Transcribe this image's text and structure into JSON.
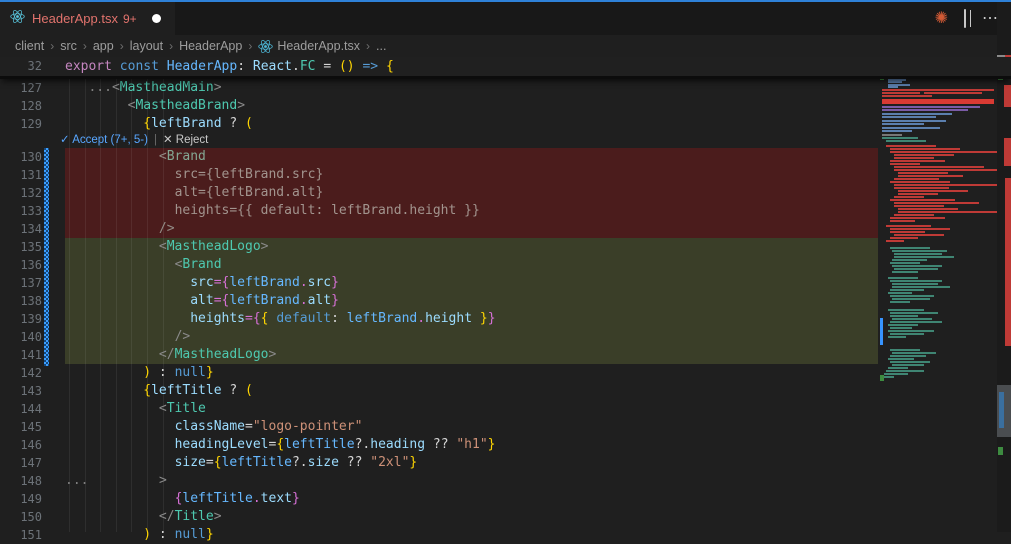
{
  "tab_bar": {
    "accent_color": "#2e81d8",
    "tab": {
      "icon": "react-icon",
      "title": "HeaderApp.tsx",
      "badge": "9+",
      "dirty": true,
      "title_color": "#e2736d"
    },
    "actions": [
      {
        "name": "ai-sparkle-icon",
        "glyph": "✺",
        "color": "#d15a35"
      },
      {
        "name": "split-editor-icon",
        "glyph": ""
      },
      {
        "name": "more-actions-icon",
        "glyph": "⋯"
      }
    ]
  },
  "breadcrumb": {
    "separator": "›",
    "segments": [
      {
        "label": "client"
      },
      {
        "label": "src"
      },
      {
        "label": "app"
      },
      {
        "label": "layout"
      },
      {
        "label": "HeaderApp"
      },
      {
        "label": "HeaderApp.tsx",
        "icon": "react-icon"
      },
      {
        "label": "..."
      }
    ]
  },
  "diff_bar": {
    "accept_label": "✓ Accept (7+, 5-)",
    "separator": "|",
    "reject_label": "✕ Reject",
    "accept_color": "#58a6ff"
  },
  "editor": {
    "background": "#1f1f1f",
    "deleted_line_bg": "#4b1c1c",
    "added_line_bg": "#3a3e28",
    "sticky_line": {
      "n": "32",
      "ind": 0,
      "tok": [
        [
          "export",
          "kw"
        ],
        [
          " ",
          "op"
        ],
        [
          "const",
          "kw2"
        ],
        [
          " ",
          "op"
        ],
        [
          "HeaderApp",
          "var2"
        ],
        [
          ": ",
          "op"
        ],
        [
          "React",
          "var"
        ],
        [
          ".",
          "op"
        ],
        [
          "FC",
          "type"
        ],
        [
          " = ",
          "op"
        ],
        [
          "()",
          "b1"
        ],
        [
          " ",
          "op"
        ],
        [
          "=>",
          "kw2"
        ],
        [
          " ",
          "op"
        ],
        [
          "{",
          "b1"
        ]
      ]
    },
    "code_lines": [
      {
        "n": "127",
        "kind": "normal",
        "ind": 3,
        "tok": [
          [
            "...",
            "dots"
          ],
          [
            "<",
            "punct"
          ],
          [
            "MastheadMain",
            "type"
          ],
          [
            ">",
            "punct"
          ]
        ]
      },
      {
        "n": "128",
        "kind": "normal",
        "ind": 8,
        "tok": [
          [
            "<",
            "punct"
          ],
          [
            "MastheadBrand",
            "type"
          ],
          [
            ">",
            "punct"
          ]
        ]
      },
      {
        "n": "129",
        "kind": "normal",
        "ind": 10,
        "tok": [
          [
            "{",
            "b1"
          ],
          [
            "leftBrand",
            "var"
          ],
          [
            " ? ",
            "op"
          ],
          [
            "(",
            "b1"
          ]
        ]
      },
      {
        "bar": true
      },
      {
        "n": "130",
        "kind": "del",
        "ind": 12,
        "tok": [
          [
            "<",
            "delp"
          ],
          [
            "Brand",
            "deltag"
          ]
        ]
      },
      {
        "n": "131",
        "kind": "del",
        "ind": 14,
        "tok": [
          [
            "src={leftBrand.src}",
            "delt"
          ]
        ]
      },
      {
        "n": "132",
        "kind": "del",
        "ind": 14,
        "tok": [
          [
            "alt={leftBrand.alt}",
            "delt"
          ]
        ]
      },
      {
        "n": "133",
        "kind": "del",
        "ind": 14,
        "tok": [
          [
            "heights={{ default: leftBrand.height }}",
            "delt"
          ]
        ]
      },
      {
        "n": "134",
        "kind": "del",
        "ind": 12,
        "tok": [
          [
            "/>",
            "delp"
          ]
        ]
      },
      {
        "n": "135",
        "kind": "add",
        "ind": 12,
        "tok": [
          [
            "<",
            "punct"
          ],
          [
            "MastheadLogo",
            "type"
          ],
          [
            ">",
            "punct"
          ]
        ]
      },
      {
        "n": "136",
        "kind": "add",
        "ind": 14,
        "tok": [
          [
            "<",
            "punct"
          ],
          [
            "Brand",
            "type"
          ]
        ]
      },
      {
        "n": "137",
        "kind": "add",
        "ind": 16,
        "tok": [
          [
            "src",
            "var"
          ],
          [
            "=",
            "b2"
          ],
          [
            "{",
            "b2"
          ],
          [
            "leftBrand",
            "var2"
          ],
          [
            ".",
            "b2"
          ],
          [
            "src",
            "var"
          ],
          [
            "}",
            "b2"
          ]
        ]
      },
      {
        "n": "138",
        "kind": "add",
        "ind": 16,
        "tok": [
          [
            "alt",
            "var"
          ],
          [
            "=",
            "b2"
          ],
          [
            "{",
            "b2"
          ],
          [
            "leftBrand",
            "var2"
          ],
          [
            ".",
            "b2"
          ],
          [
            "alt",
            "var"
          ],
          [
            "}",
            "b2"
          ]
        ]
      },
      {
        "n": "139",
        "kind": "add",
        "ind": 16,
        "tok": [
          [
            "heights",
            "var"
          ],
          [
            "=",
            "b2"
          ],
          [
            "{",
            "b2"
          ],
          [
            "{",
            "b1"
          ],
          [
            " ",
            "op"
          ],
          [
            "default",
            "kw2"
          ],
          [
            ": ",
            "op"
          ],
          [
            "leftBrand",
            "var2"
          ],
          [
            ".",
            "b2"
          ],
          [
            "height",
            "var"
          ],
          [
            " ",
            "op"
          ],
          [
            "}",
            "b1"
          ],
          [
            "}",
            "b2"
          ]
        ]
      },
      {
        "n": "140",
        "kind": "add",
        "ind": 14,
        "tok": [
          [
            "/>",
            "punct"
          ]
        ]
      },
      {
        "n": "141",
        "kind": "add",
        "ind": 12,
        "tok": [
          [
            "</",
            "punct"
          ],
          [
            "MastheadLogo",
            "type"
          ],
          [
            ">",
            "punct"
          ]
        ]
      },
      {
        "n": "142",
        "kind": "normal",
        "ind": 10,
        "tok": [
          [
            ")",
            "b1"
          ],
          [
            " : ",
            "op"
          ],
          [
            "null",
            "kw2"
          ],
          [
            "}",
            "b1"
          ]
        ]
      },
      {
        "n": "143",
        "kind": "normal",
        "ind": 10,
        "tok": [
          [
            "{",
            "b1"
          ],
          [
            "leftTitle",
            "var"
          ],
          [
            " ? ",
            "op"
          ],
          [
            "(",
            "b1"
          ]
        ]
      },
      {
        "n": "144",
        "kind": "normal",
        "ind": 12,
        "tok": [
          [
            "<",
            "punct"
          ],
          [
            "Title",
            "type"
          ]
        ]
      },
      {
        "n": "145",
        "kind": "normal",
        "ind": 14,
        "tok": [
          [
            "className",
            "var"
          ],
          [
            "=",
            "op"
          ],
          [
            "\"logo-pointer\"",
            "str"
          ]
        ]
      },
      {
        "n": "146",
        "kind": "normal",
        "ind": 14,
        "tok": [
          [
            "headingLevel",
            "var"
          ],
          [
            "=",
            "op"
          ],
          [
            "{",
            "b1"
          ],
          [
            "leftTitle",
            "var2"
          ],
          [
            "?.",
            "op"
          ],
          [
            "heading",
            "var"
          ],
          [
            " ?? ",
            "op"
          ],
          [
            "\"h1\"",
            "str"
          ],
          [
            "}",
            "b1"
          ]
        ]
      },
      {
        "n": "147",
        "kind": "normal",
        "ind": 14,
        "tok": [
          [
            "size",
            "var"
          ],
          [
            "=",
            "op"
          ],
          [
            "{",
            "b1"
          ],
          [
            "leftTitle",
            "var2"
          ],
          [
            "?.",
            "op"
          ],
          [
            "size",
            "var"
          ],
          [
            " ?? ",
            "op"
          ],
          [
            "\"2xl\"",
            "str"
          ],
          [
            "}",
            "b1"
          ]
        ]
      },
      {
        "n": "148",
        "kind": "normal",
        "ind": 0,
        "tok": [
          [
            "...",
            "dots"
          ],
          [
            "         ",
            "op"
          ],
          [
            ">",
            "punct"
          ]
        ]
      },
      {
        "n": "149",
        "kind": "normal",
        "ind": 14,
        "tok": [
          [
            "{",
            "b2"
          ],
          [
            "leftTitle",
            "var2"
          ],
          [
            ".",
            "b2"
          ],
          [
            "text",
            "var"
          ],
          [
            "}",
            "b2"
          ]
        ]
      },
      {
        "n": "150",
        "kind": "normal",
        "ind": 12,
        "tok": [
          [
            "</",
            "punct"
          ],
          [
            "Title",
            "type"
          ],
          [
            ">",
            "punct"
          ]
        ]
      },
      {
        "n": "151",
        "kind": "normal",
        "ind": 10,
        "tok": [
          [
            ")",
            "b1"
          ],
          [
            " : ",
            "op"
          ],
          [
            "null",
            "kw2"
          ],
          [
            "}",
            "b1"
          ]
        ]
      }
    ]
  },
  "minimap": {
    "palette": {
      "b": "#5b7fae",
      "r": "#bf3a36",
      "R": "#d93a33",
      "p": "#7a5ba6",
      "t": "#3f8573",
      "g": "#777777",
      "B": "#3794ff",
      "G": "#3d8b40"
    },
    "rects": [
      [
        2,
        1,
        30,
        2,
        "b"
      ],
      [
        34,
        1,
        62,
        2,
        "r"
      ],
      [
        8,
        4,
        18,
        2,
        "b"
      ],
      [
        8,
        7,
        24,
        2,
        "b"
      ],
      [
        8,
        9,
        28,
        2,
        "b"
      ],
      [
        8,
        12,
        22,
        2,
        "b"
      ],
      [
        8,
        14,
        30,
        2,
        "b"
      ],
      [
        8,
        17,
        26,
        2,
        "b"
      ],
      [
        8,
        19,
        24,
        2,
        "b"
      ],
      [
        8,
        22,
        18,
        2,
        "b"
      ],
      [
        8,
        24,
        14,
        2,
        "b"
      ],
      [
        8,
        27,
        22,
        2,
        "b"
      ],
      [
        8,
        29,
        10,
        2,
        "b"
      ],
      [
        2,
        32,
        112,
        2,
        "r"
      ],
      [
        2,
        35,
        38,
        2,
        "r"
      ],
      [
        44,
        35,
        58,
        2,
        "r"
      ],
      [
        2,
        38,
        50,
        2,
        "r"
      ],
      [
        2,
        42,
        112,
        5,
        "R"
      ],
      [
        2,
        49,
        98,
        2,
        "p"
      ],
      [
        2,
        52,
        86,
        2,
        "p"
      ],
      [
        2,
        56,
        70,
        2,
        "b"
      ],
      [
        2,
        59,
        54,
        2,
        "b"
      ],
      [
        2,
        63,
        64,
        2,
        "b"
      ],
      [
        2,
        66,
        42,
        2,
        "b"
      ],
      [
        2,
        70,
        58,
        2,
        "b"
      ],
      [
        2,
        73,
        30,
        2,
        "b"
      ],
      [
        2,
        77,
        20,
        2,
        "g"
      ],
      [
        2,
        80,
        36,
        2,
        "t"
      ],
      [
        6,
        83,
        40,
        2,
        "t"
      ],
      [
        6,
        88,
        50,
        2,
        "r"
      ],
      [
        10,
        91,
        70,
        2,
        "r"
      ],
      [
        10,
        94,
        112,
        2,
        "r"
      ],
      [
        14,
        97,
        60,
        2,
        "r"
      ],
      [
        14,
        100,
        40,
        2,
        "r"
      ],
      [
        10,
        103,
        55,
        2,
        "r"
      ],
      [
        10,
        106,
        30,
        2,
        "r"
      ],
      [
        14,
        109,
        90,
        2,
        "r"
      ],
      [
        14,
        112,
        112,
        2,
        "r"
      ],
      [
        18,
        115,
        50,
        2,
        "r"
      ],
      [
        18,
        118,
        65,
        2,
        "r"
      ],
      [
        14,
        121,
        45,
        2,
        "r"
      ],
      [
        10,
        124,
        60,
        2,
        "r"
      ],
      [
        14,
        127,
        112,
        2,
        "r"
      ],
      [
        14,
        130,
        55,
        2,
        "r"
      ],
      [
        18,
        133,
        70,
        2,
        "r"
      ],
      [
        18,
        136,
        40,
        2,
        "r"
      ],
      [
        14,
        139,
        30,
        2,
        "r"
      ],
      [
        10,
        142,
        65,
        2,
        "r"
      ],
      [
        14,
        145,
        85,
        2,
        "r"
      ],
      [
        14,
        148,
        50,
        2,
        "r"
      ],
      [
        18,
        151,
        60,
        2,
        "r"
      ],
      [
        18,
        154,
        112,
        2,
        "r"
      ],
      [
        14,
        157,
        40,
        2,
        "r"
      ],
      [
        10,
        160,
        55,
        2,
        "r"
      ],
      [
        10,
        163,
        25,
        2,
        "r"
      ],
      [
        6,
        168,
        45,
        2,
        "r"
      ],
      [
        10,
        171,
        60,
        2,
        "r"
      ],
      [
        10,
        174,
        35,
        2,
        "r"
      ],
      [
        14,
        177,
        50,
        2,
        "r"
      ],
      [
        10,
        180,
        28,
        2,
        "r"
      ],
      [
        6,
        183,
        18,
        2,
        "r"
      ],
      [
        10,
        190,
        40,
        2,
        "t"
      ],
      [
        12,
        193,
        55,
        2,
        "t"
      ],
      [
        14,
        196,
        48,
        2,
        "t"
      ],
      [
        14,
        199,
        60,
        2,
        "t"
      ],
      [
        12,
        202,
        35,
        2,
        "t"
      ],
      [
        10,
        205,
        30,
        2,
        "t"
      ],
      [
        12,
        208,
        50,
        2,
        "t"
      ],
      [
        14,
        211,
        44,
        2,
        "t"
      ],
      [
        12,
        214,
        26,
        2,
        "t"
      ],
      [
        8,
        220,
        30,
        2,
        "t"
      ],
      [
        10,
        223,
        52,
        2,
        "t"
      ],
      [
        12,
        226,
        46,
        2,
        "t"
      ],
      [
        12,
        229,
        58,
        2,
        "t"
      ],
      [
        10,
        232,
        34,
        2,
        "t"
      ],
      [
        8,
        235,
        24,
        2,
        "t"
      ],
      [
        10,
        238,
        44,
        2,
        "t"
      ],
      [
        12,
        241,
        38,
        2,
        "t"
      ],
      [
        10,
        244,
        20,
        2,
        "t"
      ],
      [
        8,
        252,
        36,
        2,
        "t"
      ],
      [
        10,
        255,
        48,
        2,
        "t"
      ],
      [
        10,
        258,
        28,
        2,
        "t"
      ],
      [
        12,
        261,
        40,
        2,
        "t"
      ],
      [
        10,
        264,
        52,
        2,
        "t"
      ],
      [
        8,
        267,
        30,
        2,
        "t"
      ],
      [
        10,
        270,
        22,
        2,
        "t"
      ],
      [
        8,
        273,
        46,
        2,
        "t"
      ],
      [
        10,
        276,
        34,
        2,
        "t"
      ],
      [
        8,
        279,
        18,
        2,
        "t"
      ],
      [
        10,
        292,
        30,
        2,
        "t"
      ],
      [
        12,
        295,
        44,
        2,
        "t"
      ],
      [
        10,
        298,
        36,
        2,
        "t"
      ],
      [
        8,
        301,
        26,
        2,
        "t"
      ],
      [
        10,
        304,
        40,
        2,
        "t"
      ],
      [
        12,
        307,
        32,
        2,
        "t"
      ],
      [
        8,
        310,
        20,
        2,
        "t"
      ],
      [
        6,
        313,
        38,
        2,
        "t"
      ],
      [
        4,
        316,
        24,
        2,
        "t"
      ],
      [
        2,
        319,
        12,
        2,
        "t"
      ],
      [
        0,
        261,
        3,
        27,
        "B"
      ],
      [
        0,
        17,
        4,
        6,
        "G"
      ],
      [
        0,
        318,
        4,
        6,
        "G"
      ]
    ]
  },
  "scrollbar": {
    "markers": [
      [
        997,
        55,
        9,
        3,
        "#8a8a8a"
      ],
      [
        1005,
        55,
        6,
        8,
        "#bf3a36"
      ],
      [
        998,
        72,
        5,
        8,
        "#3d8b40"
      ],
      [
        1004,
        85,
        7,
        22,
        "#bf3a36"
      ],
      [
        1004,
        138,
        7,
        28,
        "#bf3a36"
      ],
      [
        1005,
        178,
        6,
        168,
        "#bf3a36"
      ],
      [
        997,
        385,
        14,
        52,
        "#4a4d50"
      ],
      [
        999,
        392,
        5,
        36,
        "#3a6f9f"
      ],
      [
        998,
        447,
        5,
        8,
        "#3d8b40"
      ]
    ]
  }
}
